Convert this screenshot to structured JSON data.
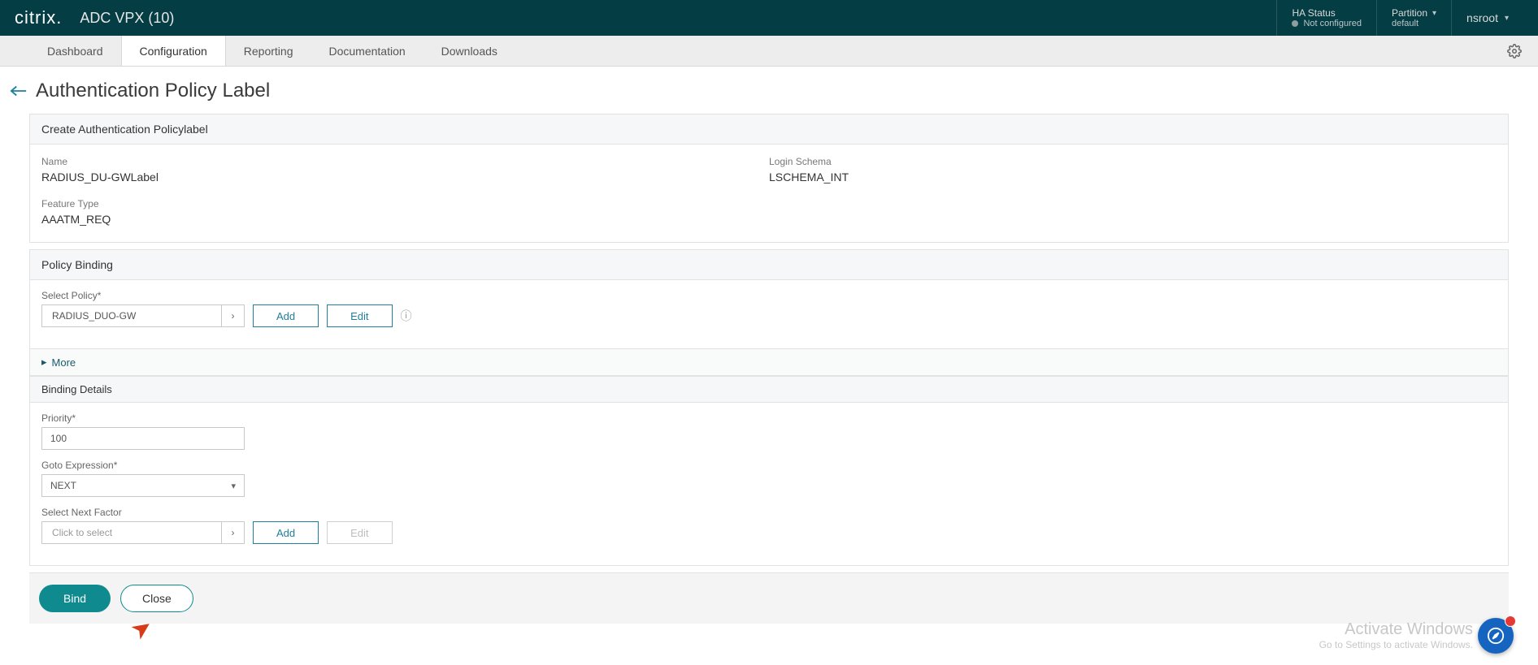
{
  "topbar": {
    "logo": "citrix.",
    "product": "ADC VPX (10)",
    "ha_label": "HA Status",
    "ha_value": "Not configured",
    "partition_label": "Partition",
    "partition_value": "default",
    "user": "nsroot"
  },
  "tabs": {
    "dashboard": "Dashboard",
    "configuration": "Configuration",
    "reporting": "Reporting",
    "documentation": "Documentation",
    "downloads": "Downloads"
  },
  "page": {
    "title": "Authentication Policy Label"
  },
  "summary": {
    "header": "Create Authentication Policylabel",
    "name_label": "Name",
    "name_value": "RADIUS_DU-GWLabel",
    "feature_label": "Feature Type",
    "feature_value": "AAATM_REQ",
    "schema_label": "Login Schema",
    "schema_value": "LSCHEMA_INT"
  },
  "binding": {
    "header": "Policy Binding",
    "select_policy_label": "Select Policy*",
    "policy_value": "RADIUS_DUO-GW",
    "add": "Add",
    "edit": "Edit",
    "more": "More",
    "details_header": "Binding Details",
    "priority_label": "Priority*",
    "priority_value": "100",
    "goto_label": "Goto Expression*",
    "goto_value": "NEXT",
    "next_factor_label": "Select Next Factor",
    "next_factor_placeholder": "Click to select"
  },
  "footer": {
    "bind": "Bind",
    "close": "Close"
  },
  "watermark": {
    "line1": "Activate Windows",
    "line2": "Go to Settings to activate Windows."
  }
}
